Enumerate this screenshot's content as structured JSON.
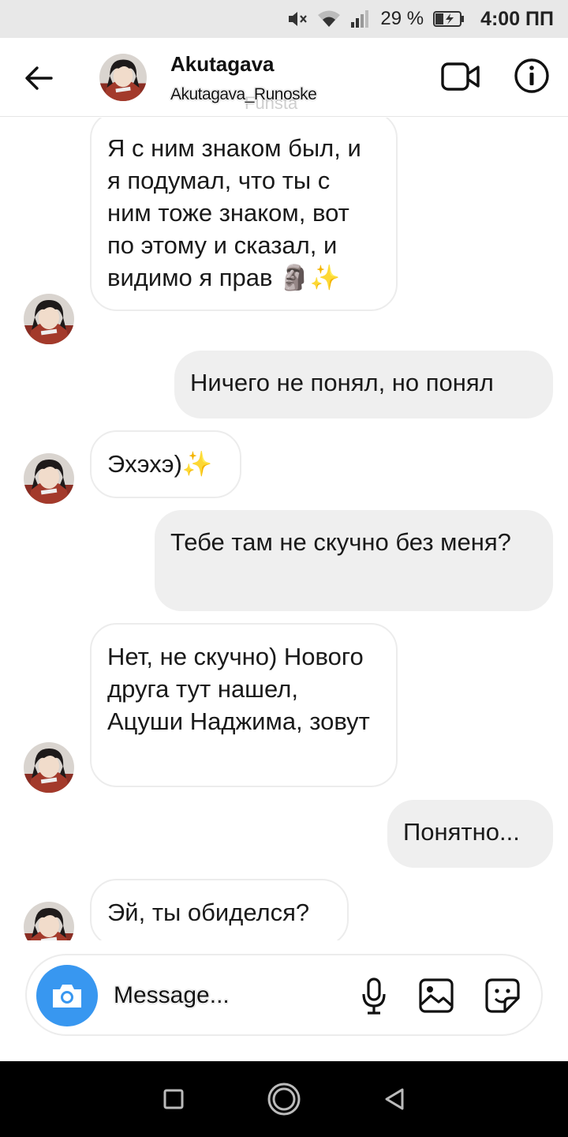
{
  "status_bar": {
    "battery": "29 %",
    "time": "4:00 ПП"
  },
  "header": {
    "title": "Akutagava",
    "subtitle": "Akutagava_Runoske",
    "ghost": "Funsta"
  },
  "messages": [
    {
      "from": "them",
      "text": "Я с ним знаком был, и я подумал, что ты с ним тоже знаком, вот по этому и сказал, и видимо я прав 🗿✨"
    },
    {
      "from": "me",
      "text": "Ничего не понял, но понял"
    },
    {
      "from": "them",
      "text": "Эхэхэ)✨"
    },
    {
      "from": "me",
      "text": "Тебе там не скучно без меня?"
    },
    {
      "from": "them",
      "text": "Нет, не скучно) Нового друга тут нашел, Ацуши Наджима, зовут"
    },
    {
      "from": "me",
      "text": "Понятно..."
    },
    {
      "from": "them",
      "text": "Эй, ты обиделся?"
    }
  ],
  "composer": {
    "placeholder": "Message..."
  },
  "colors": {
    "accent": "#3897f0",
    "incoming_bg": "#ffffff",
    "outgoing_bg": "#efefef"
  },
  "icons": {
    "status": [
      "mute-icon",
      "wifi-icon",
      "signal-icon",
      "battery-icon"
    ],
    "header": [
      "back-arrow-icon",
      "video-call-icon",
      "info-icon"
    ],
    "composer": [
      "camera-icon",
      "microphone-icon",
      "gallery-icon",
      "sticker-icon"
    ],
    "nav": [
      "recent-apps-icon",
      "home-icon",
      "back-icon"
    ]
  }
}
